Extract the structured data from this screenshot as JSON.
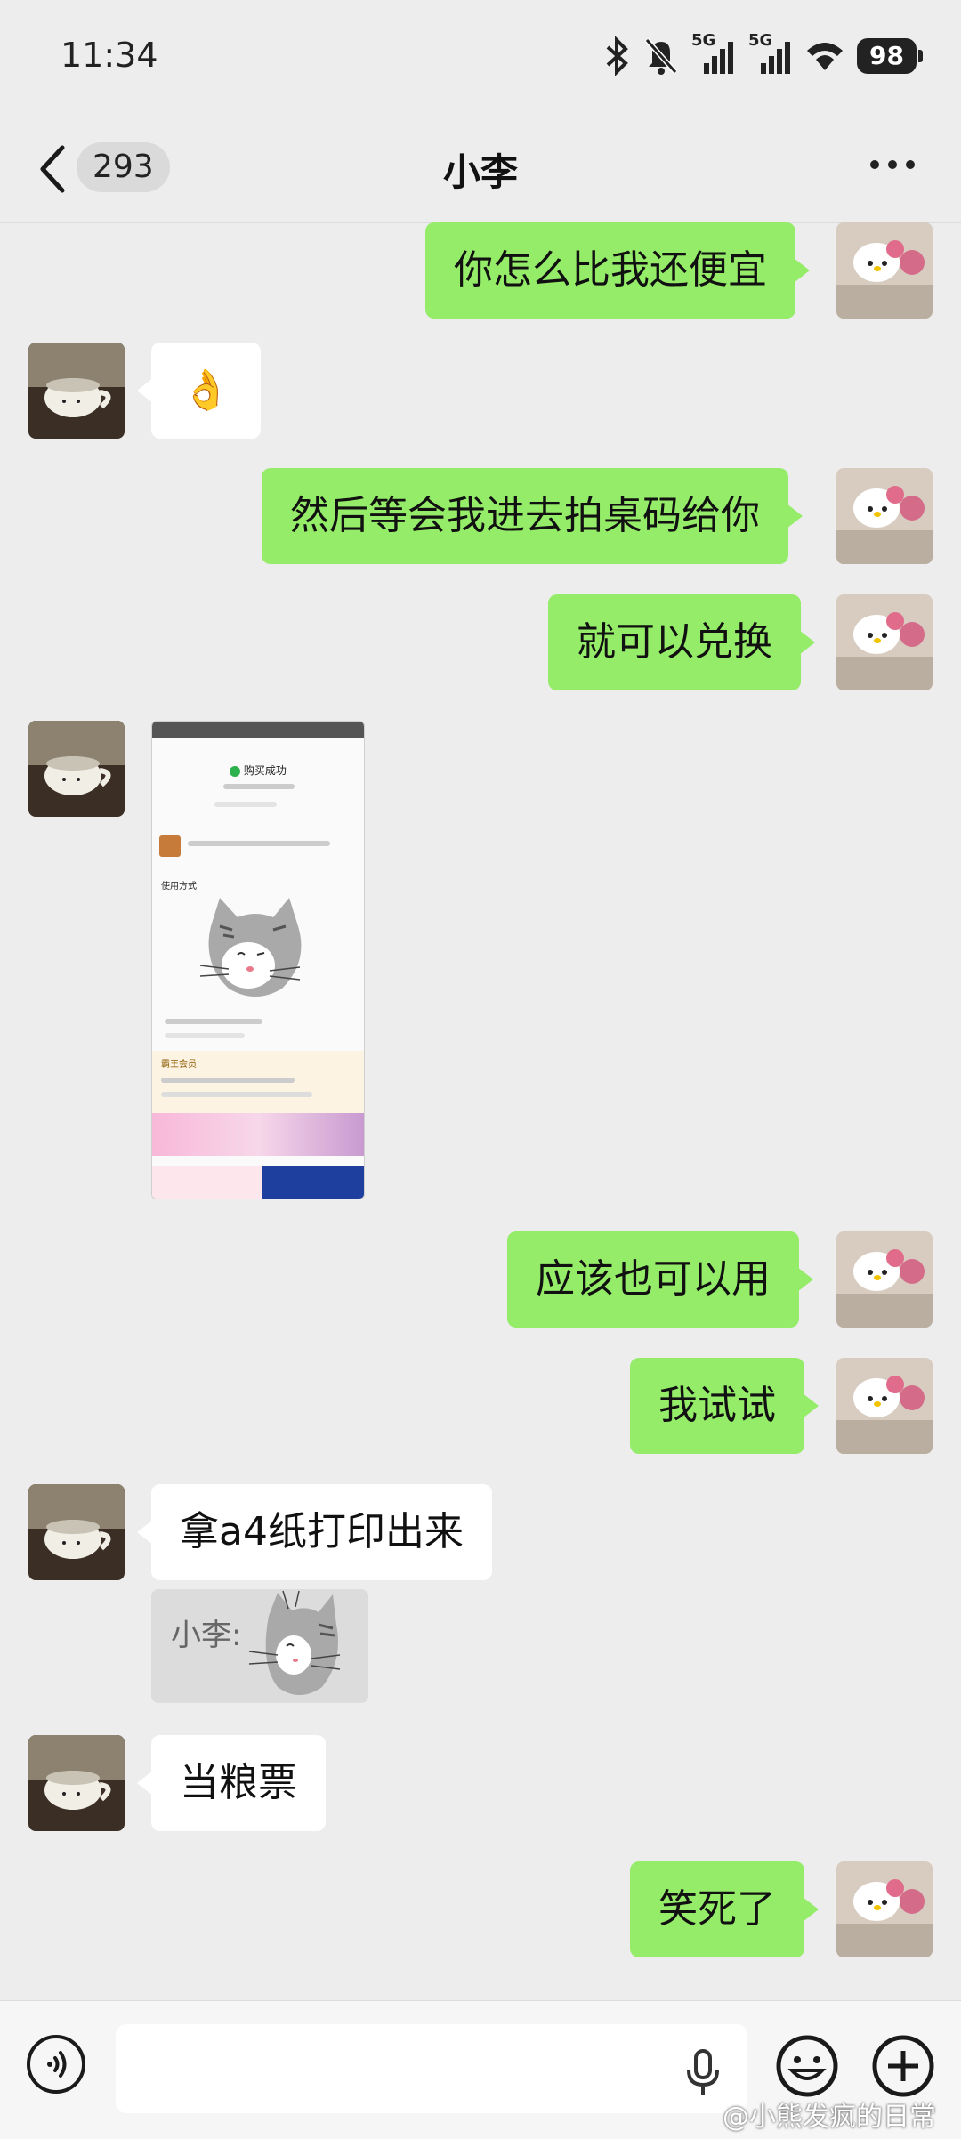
{
  "status_bar": {
    "time": "11:34",
    "network_1": "5G",
    "network_2": "5G",
    "battery": "98"
  },
  "nav": {
    "unread_count": "293",
    "title": "小李"
  },
  "messages": [
    {
      "side": "right",
      "text": "你怎么比我还便宜"
    },
    {
      "side": "left",
      "text": "👌"
    },
    {
      "side": "right",
      "text": "然后等会我进去拍桌码给你"
    },
    {
      "side": "right",
      "text": "就可以兑换"
    },
    {
      "side": "left",
      "type": "image"
    },
    {
      "side": "right",
      "text": "应该也可以用"
    },
    {
      "side": "right",
      "text": "我试试"
    },
    {
      "side": "left",
      "text": "拿a4纸打印出来"
    },
    {
      "side": "left",
      "text": "当粮票"
    },
    {
      "side": "right",
      "text": "笑死了"
    }
  ],
  "quote": {
    "label": "小李:"
  },
  "shared_image": {
    "header": "购买成功",
    "section": "使用方式",
    "member": "霸王会员"
  },
  "input": {
    "value": "",
    "placeholder": ""
  },
  "watermark": "@小熊发疯的日常",
  "colors": {
    "outgoing_bubble": "#95ec69",
    "incoming_bubble": "#ffffff",
    "background": "#ededed"
  }
}
